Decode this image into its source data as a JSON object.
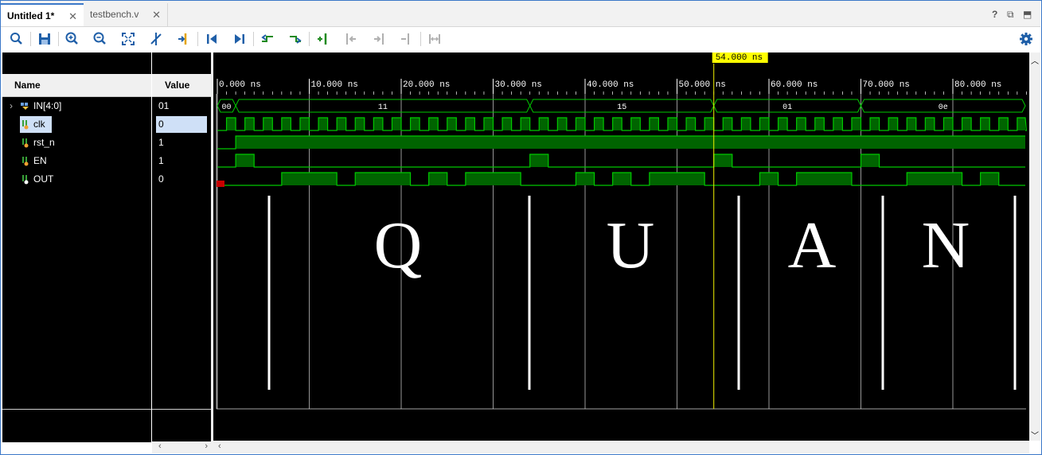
{
  "tabs": [
    {
      "label": "Untitled 1*",
      "active": true
    },
    {
      "label": "testbench.v",
      "active": false
    }
  ],
  "window_controls": [
    "?",
    "restore-icon",
    "maximize-icon"
  ],
  "toolbar": {
    "icons": [
      "search-icon",
      "save-icon",
      "zoom-in-icon",
      "zoom-out-icon",
      "zoom-fit-icon",
      "no-cursor-icon",
      "marker-icon",
      "go-first-icon",
      "go-last-icon",
      "prev-transition-icon",
      "next-transition-icon",
      "add-marker-icon",
      "prev-marker-icon",
      "next-marker-icon",
      "swap-markers-icon",
      "range-icon"
    ],
    "settings_icon": "gear-icon"
  },
  "columns": {
    "name": "Name",
    "value": "Value"
  },
  "signals": [
    {
      "name": "IN[4:0]",
      "value": "01",
      "type": "bus",
      "selected": false
    },
    {
      "name": "clk",
      "value": "0",
      "type": "bit",
      "selected": true
    },
    {
      "name": "rst_n",
      "value": "1",
      "type": "bit",
      "selected": false
    },
    {
      "name": "EN",
      "value": "1",
      "type": "bit",
      "selected": false
    },
    {
      "name": "OUT",
      "value": "0",
      "type": "bit",
      "selected": false
    }
  ],
  "cursor_label": "54.000 ns",
  "time_ticks": [
    "0.000 ns",
    "10.000 ns",
    "20.000 ns",
    "30.000 ns",
    "40.000 ns",
    "50.000 ns",
    "60.000 ns",
    "70.000 ns",
    "80.000 ns"
  ],
  "bus_values": [
    "00",
    "11",
    "15",
    "01",
    "0e"
  ],
  "overlay_letters": [
    "Q",
    "U",
    "A",
    "N"
  ],
  "colors": {
    "wave": "#00c800",
    "wave_fill": "#006400",
    "background": "#000000",
    "cursor_label_bg": "#ffff00",
    "accent": "#3b78c8"
  }
}
